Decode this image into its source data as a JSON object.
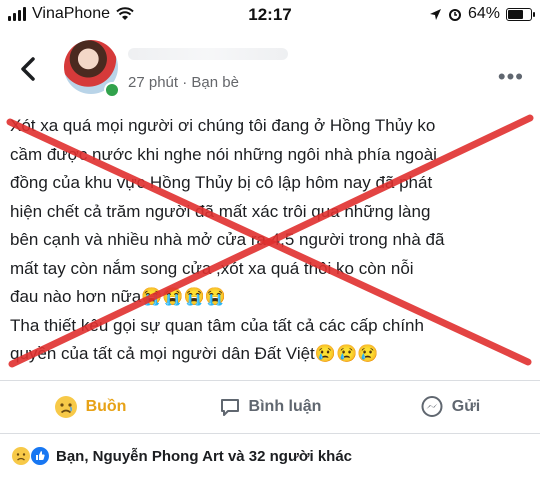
{
  "status_bar": {
    "carrier": "VinaPhone",
    "time": "12:17",
    "battery": "64%",
    "battery_level": 0.64
  },
  "post": {
    "time": "27 phút",
    "separator": "·",
    "audience": "Bạn bè",
    "lines": [
      "Xót xa quá mọi người ơi chúng tôi đang ở Hồng Thủy ko",
      "cầm được nước khi nghe nói những ngôi nhà phía ngoài",
      "đồng của khu vực Hồng Thủy bị cô lập hôm nay đã phát",
      "hiện chết cả trăm người đã mất xác trôi qua những làng",
      "bên cạnh và nhiều nhà mở cửa ra 4,5 người trong nhà đã",
      "mất tay còn nắm song cửa ,xót xa quá thôi ko còn nỗi",
      "đau nào hơn nữa😭😭😭😭",
      "Tha thiết kêu gọi sự quan tâm của tất cả các cấp chính",
      "quyền của tất cả mọi người dân Đất Việt😢😢😢"
    ],
    "cross_color": "#e0302f"
  },
  "actions": {
    "reaction": "Buồn",
    "comment": "Bình luận",
    "share": "Gửi"
  },
  "reactions_summary": "Bạn, Nguyễn Phong Art và 32 người khác",
  "colors": {
    "sad": "#e7a217",
    "muted": "#606770",
    "like_blue": "#1877f2"
  }
}
